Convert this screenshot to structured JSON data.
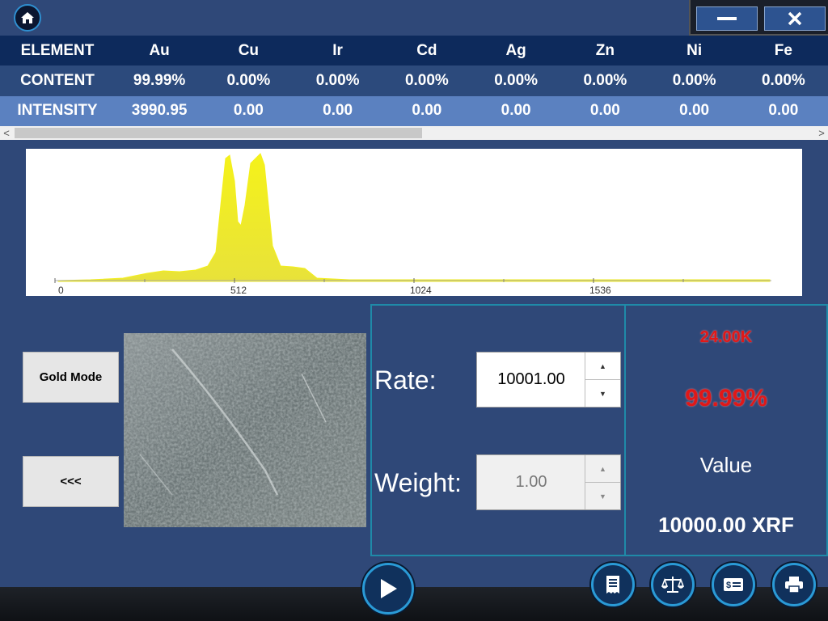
{
  "window": {
    "icons": {
      "home": "home-icon",
      "minimize": "minimize-icon",
      "close": "close-icon"
    }
  },
  "table": {
    "headers": [
      "ELEMENT",
      "Au",
      "Cu",
      "Ir",
      "Cd",
      "Ag",
      "Zn",
      "Ni",
      "Fe"
    ],
    "content": [
      "CONTENT",
      "99.99%",
      "0.00%",
      "0.00%",
      "0.00%",
      "0.00%",
      "0.00%",
      "0.00%",
      "0.00%"
    ],
    "intensity": [
      "INTENSITY",
      "3990.95",
      "0.00",
      "0.00",
      "0.00",
      "0.00",
      "0.00",
      "0.00",
      "0.00"
    ]
  },
  "scrollbar": {
    "left_arrow": "<",
    "right_arrow": ">"
  },
  "spectrum": {
    "chart_data": {
      "type": "area",
      "x_ticks": [
        "0",
        "512",
        "1024",
        "1536"
      ],
      "xlim": [
        0,
        2048
      ],
      "color": "#f2ef1a",
      "series_shape": "two peaks near channel 487 and 577 over a small hump between 250 and 770"
    }
  },
  "controls": {
    "gold_mode_label": "Gold Mode",
    "back_label": "<<<"
  },
  "inputs": {
    "rate_label": "Rate:",
    "rate_value": "10001.00",
    "weight_label": "Weight:",
    "weight_value": "1.00",
    "up_arrow": "▲",
    "down_arrow": "▼"
  },
  "result": {
    "karat": "24.00K",
    "purity": "99.99%",
    "value_label": "Value",
    "value_amount": "10000.00 XRF",
    "alert_color": "#e01818"
  },
  "bottom": {
    "icons": [
      "play-icon",
      "receipt-icon",
      "scale-icon",
      "money-icon",
      "printer-icon"
    ]
  }
}
